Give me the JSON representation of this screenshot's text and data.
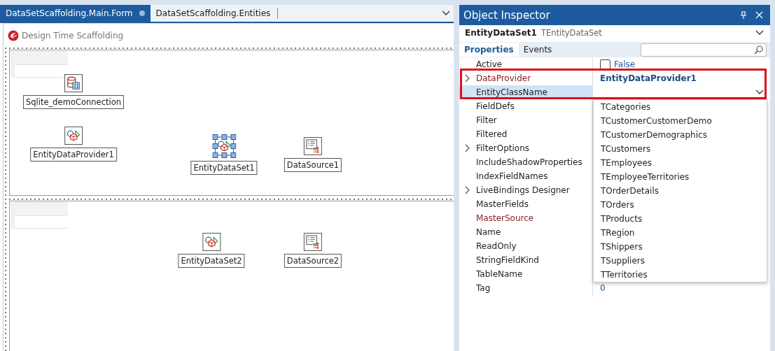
{
  "editor": {
    "tabs": [
      {
        "label": "DataSetScaffolding.Main.Form",
        "selected": true,
        "modified": true
      },
      {
        "label": "DataSetScaffolding.Entities",
        "selected": false,
        "modified": false
      }
    ]
  },
  "form": {
    "caption": "Design Time Scaffolding",
    "panels": [
      {
        "components": [
          {
            "name": "Sqlite_demoConnection",
            "kind": "connection",
            "selected": false
          },
          {
            "name": "EntityDataProvider1",
            "kind": "provider",
            "selected": false
          },
          {
            "name": "EntityDataSet1",
            "kind": "dataset",
            "selected": true
          },
          {
            "name": "DataSource1",
            "kind": "datasource",
            "selected": false
          }
        ]
      },
      {
        "components": [
          {
            "name": "EntityDataSet2",
            "kind": "dataset",
            "selected": false
          },
          {
            "name": "DataSource2",
            "kind": "datasource",
            "selected": false
          }
        ]
      }
    ]
  },
  "object_inspector": {
    "title": "Object Inspector",
    "component": {
      "name": "EntityDataSet1",
      "type": "TEntityDataSet"
    },
    "tabs": [
      {
        "label": "Properties",
        "selected": true
      },
      {
        "label": "Events",
        "selected": false
      }
    ],
    "properties": [
      {
        "name": "Active",
        "expandable": false,
        "reference": false,
        "selected": false,
        "value": {
          "kind": "checkbox",
          "text": "False",
          "checked": false
        }
      },
      {
        "name": "DataProvider",
        "expandable": true,
        "reference": true,
        "selected": false,
        "value": {
          "kind": "bold",
          "text": "EntityDataProvider1"
        }
      },
      {
        "name": "EntityClassName",
        "expandable": false,
        "reference": false,
        "selected": true,
        "value": {
          "kind": "dropdown"
        }
      },
      {
        "name": "FieldDefs",
        "expandable": false,
        "reference": false,
        "selected": false
      },
      {
        "name": "Filter",
        "expandable": false,
        "reference": false,
        "selected": false
      },
      {
        "name": "Filtered",
        "expandable": false,
        "reference": false,
        "selected": false
      },
      {
        "name": "FilterOptions",
        "expandable": true,
        "reference": false,
        "selected": false
      },
      {
        "name": "IncludeShadowProperties",
        "expandable": false,
        "reference": false,
        "selected": false
      },
      {
        "name": "IndexFieldNames",
        "expandable": false,
        "reference": false,
        "selected": false
      },
      {
        "name": "LiveBindings Designer",
        "expandable": true,
        "reference": false,
        "selected": false
      },
      {
        "name": "MasterFields",
        "expandable": false,
        "reference": false,
        "selected": false
      },
      {
        "name": "MasterSource",
        "expandable": false,
        "reference": true,
        "selected": false
      },
      {
        "name": "Name",
        "expandable": false,
        "reference": false,
        "selected": false
      },
      {
        "name": "ReadOnly",
        "expandable": false,
        "reference": false,
        "selected": false
      },
      {
        "name": "StringFieldKind",
        "expandable": false,
        "reference": false,
        "selected": false
      },
      {
        "name": "TableName",
        "expandable": false,
        "reference": false,
        "selected": false
      },
      {
        "name": "Tag",
        "expandable": false,
        "reference": false,
        "selected": false,
        "value": {
          "kind": "number",
          "text": "0"
        }
      }
    ],
    "dropdown_items": [
      "TCategories",
      "TCustomerCustomerDemo",
      "TCustomerDemographics",
      "TCustomers",
      "TEmployees",
      "TEmployeeTerritories",
      "TOrderDetails",
      "TOrders",
      "TProducts",
      "TRegion",
      "TShippers",
      "TSuppliers",
      "TTerritories"
    ]
  }
}
